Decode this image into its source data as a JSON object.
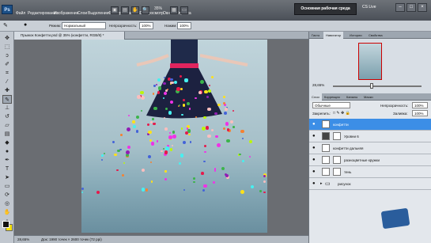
{
  "app": {
    "logo": "Ps"
  },
  "menu": [
    "Файл",
    "Редактирование",
    "Изображение",
    "Слои",
    "Выделение",
    "Фильтр",
    "Анализ",
    "3D",
    "Просмотр",
    "Окно",
    "Справка"
  ],
  "zoom_top": "35%",
  "workspace": "Основная рабочая среда",
  "cs_live": "CS Live",
  "window_buttons": [
    "–",
    "□",
    "×"
  ],
  "options_bar": {
    "mode_label": "Режим:",
    "mode_value": "Нормальный",
    "opacity_label": "Непрозрачность:",
    "opacity_value": "100%",
    "pressure_label": "Нажим:",
    "pressure_value": "100%"
  },
  "document": {
    "tab_title": "Прыжок Конфетти.psd @ 35% (конфетти, RGB/8) *",
    "zoom": "28,65%",
    "status": "Док: 1990 точек × 2600 точек (72 ppi)"
  },
  "navigator": {
    "tabs": [
      "Гисто",
      "Навигатор",
      "Истории",
      "Свойства"
    ],
    "zoom": "28,65%"
  },
  "layers_panel": {
    "tabs": [
      "Слои",
      "Коррекция",
      "Каналы",
      "Маски"
    ],
    "blend_mode": "Обычные",
    "opacity_label": "Непрозрачность:",
    "opacity_value": "100%",
    "lock_label": "Закрепить:",
    "fill_label": "Заливка:",
    "fill_value": "100%",
    "layers": [
      {
        "name": "конфетти",
        "active": true
      },
      {
        "name": "Уровни 6",
        "active": false
      },
      {
        "name": "конфетти дальняя",
        "active": false
      },
      {
        "name": "разноцветные кружки",
        "active": false
      },
      {
        "name": "тень",
        "active": false
      },
      {
        "name": "рисунок",
        "active": false
      }
    ]
  },
  "tool_icons": [
    "move-icon",
    "marquee-icon",
    "lasso-icon",
    "quick-select-icon",
    "crop-icon",
    "eyedropper-icon",
    "healing-icon",
    "brush-icon",
    "stamp-icon",
    "history-brush-icon",
    "eraser-icon",
    "gradient-icon",
    "blur-icon",
    "dodge-icon",
    "pen-icon",
    "type-icon",
    "path-select-icon",
    "shape-icon",
    "3d-rotate-icon",
    "3d-orbit-icon",
    "hand-icon",
    "zoom-icon"
  ],
  "colors": {
    "foreground": "#111111",
    "background": "#f4e00d",
    "accent": "#3c8ee6"
  }
}
